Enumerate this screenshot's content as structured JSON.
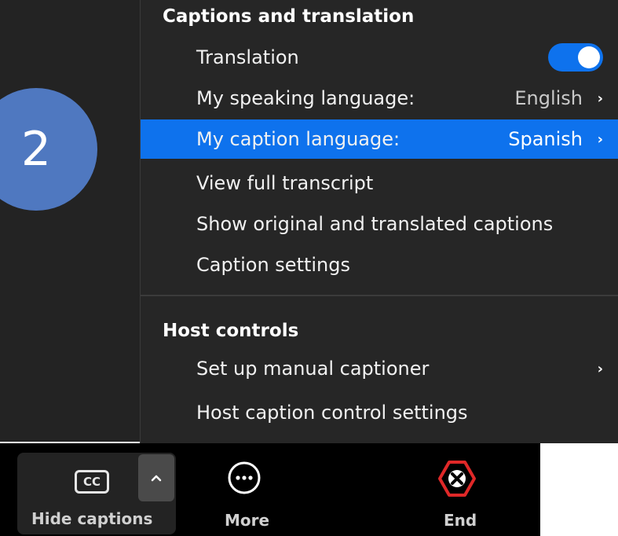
{
  "step_badge": {
    "number": "2",
    "color": "#4f78c0"
  },
  "menu": {
    "captions_section": {
      "title": "Captions and translation",
      "items": [
        {
          "label": "Translation",
          "type": "toggle",
          "toggle_on": true
        },
        {
          "label": "My speaking language:",
          "value": "English",
          "icon": "chevron-right-icon"
        },
        {
          "label": "My caption language:",
          "value": "Spanish",
          "icon": "chevron-right-icon",
          "highlighted": true
        },
        {
          "label": "View full transcript"
        },
        {
          "label": "Show original and translated captions"
        },
        {
          "label": "Caption settings"
        }
      ]
    },
    "host_section": {
      "title": "Host controls",
      "items": [
        {
          "label": "Set up manual captioner",
          "icon": "chevron-right-icon"
        },
        {
          "label": "Host caption control settings"
        }
      ]
    },
    "colors": {
      "accent": "#0e72ed",
      "background": "#262626"
    }
  },
  "toolbar": {
    "captions": {
      "icon_text": "CC",
      "label": "Hide captions",
      "caret_icon": "chevron-up-icon"
    },
    "more": {
      "label": "More",
      "icon": "more-dots-icon"
    },
    "end": {
      "label": "End",
      "icon": "end-icon",
      "color": "#e02828"
    }
  }
}
